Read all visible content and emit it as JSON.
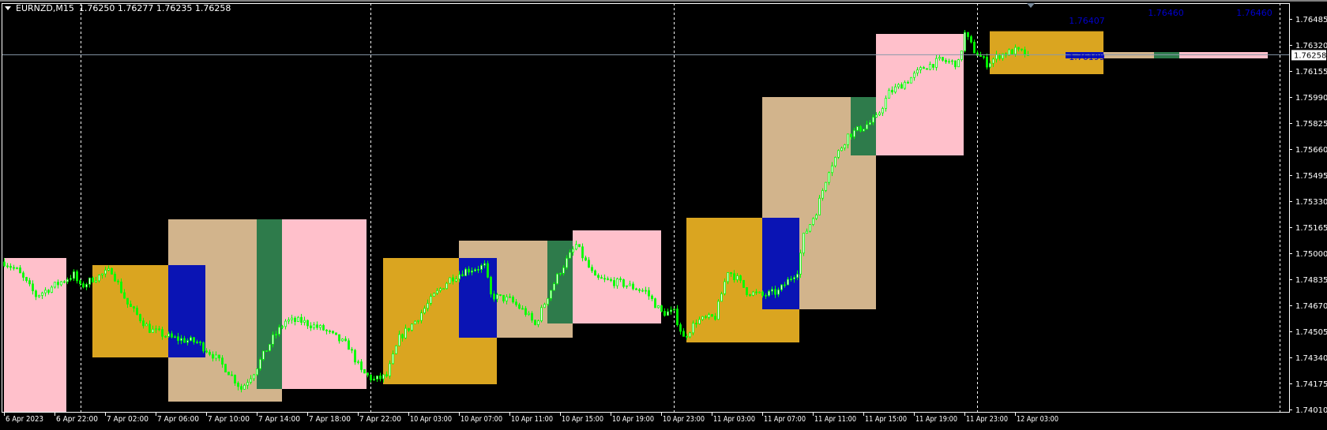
{
  "header": {
    "symbol": "EURNZD,M15",
    "ohlc": "1.76250 1.76277 1.76235 1.76258"
  },
  "colors": {
    "background": "#000000",
    "axis": "#ffffff",
    "candle": "#00ff00",
    "grid_sep": "#ffffff",
    "price_line": "#8899aa",
    "level_text": "#0000cc"
  },
  "chart_data": {
    "type": "candlestick",
    "title": "EURNZD,M15",
    "ylim": [
      1.7401,
      1.76485
    ],
    "y_ticks": [
      "1.76485",
      "1.76320",
      "1.76155",
      "1.75990",
      "1.75825",
      "1.75660",
      "1.75495",
      "1.75330",
      "1.75165",
      "1.75000",
      "1.74835",
      "1.74670",
      "1.74505",
      "1.74340",
      "1.74175",
      "1.74010"
    ],
    "current_price": "1.76258",
    "x_ticks": [
      {
        "bar": 0,
        "label": "6 Apr 2023"
      },
      {
        "bar": 16,
        "label": "6 Apr 22:00"
      },
      {
        "bar": 32,
        "label": "7 Apr 02:00"
      },
      {
        "bar": 48,
        "label": "7 Apr 06:00"
      },
      {
        "bar": 64,
        "label": "7 Apr 10:00"
      },
      {
        "bar": 80,
        "label": "7 Apr 14:00"
      },
      {
        "bar": 96,
        "label": "7 Apr 18:00"
      },
      {
        "bar": 112,
        "label": "7 Apr 22:00"
      },
      {
        "bar": 128,
        "label": "10 Apr 03:00"
      },
      {
        "bar": 144,
        "label": "10 Apr 07:00"
      },
      {
        "bar": 160,
        "label": "10 Apr 11:00"
      },
      {
        "bar": 176,
        "label": "10 Apr 15:00"
      },
      {
        "bar": 192,
        "label": "10 Apr 19:00"
      },
      {
        "bar": 208,
        "label": "10 Apr 23:00"
      },
      {
        "bar": 224,
        "label": "11 Apr 03:00"
      },
      {
        "bar": 240,
        "label": "11 Apr 07:00"
      },
      {
        "bar": 256,
        "label": "11 Apr 11:00"
      },
      {
        "bar": 272,
        "label": "11 Apr 15:00"
      },
      {
        "bar": 288,
        "label": "11 Apr 19:00"
      },
      {
        "bar": 304,
        "label": "11 Apr 23:00"
      },
      {
        "bar": 320,
        "label": "12 Apr 03:00"
      }
    ],
    "day_separators": [
      24.5,
      116.25,
      212.25,
      308.25,
      404
    ],
    "price_path": [
      [
        0,
        1.74945
      ],
      [
        4,
        1.74892
      ],
      [
        10,
        1.74731
      ],
      [
        15,
        1.74785
      ],
      [
        22,
        1.74865
      ],
      [
        24,
        1.74785
      ],
      [
        28,
        1.74838
      ],
      [
        34,
        1.74892
      ],
      [
        39,
        1.74678
      ],
      [
        46,
        1.74517
      ],
      [
        53,
        1.74463
      ],
      [
        61,
        1.74437
      ],
      [
        66,
        1.74356
      ],
      [
        71,
        1.74249
      ],
      [
        75,
        1.74142
      ],
      [
        79,
        1.74249
      ],
      [
        85,
        1.74463
      ],
      [
        89,
        1.7457
      ],
      [
        94,
        1.7457
      ],
      [
        101,
        1.74517
      ],
      [
        109,
        1.7441
      ],
      [
        113,
        1.74249
      ],
      [
        117,
        1.74196
      ],
      [
        121,
        1.74222
      ],
      [
        125,
        1.74463
      ],
      [
        130,
        1.7457
      ],
      [
        136,
        1.74731
      ],
      [
        141,
        1.74838
      ],
      [
        146,
        1.74892
      ],
      [
        152,
        1.74919
      ],
      [
        154,
        1.74731
      ],
      [
        160,
        1.74704
      ],
      [
        165,
        1.74624
      ],
      [
        168,
        1.74544
      ],
      [
        172,
        1.74731
      ],
      [
        176,
        1.74892
      ],
      [
        181,
        1.75052
      ],
      [
        187,
        1.74838
      ],
      [
        195,
        1.74811
      ],
      [
        203,
        1.74758
      ],
      [
        208,
        1.74624
      ],
      [
        212,
        1.74624
      ],
      [
        215,
        1.74463
      ],
      [
        219,
        1.7457
      ],
      [
        225,
        1.74597
      ],
      [
        229,
        1.74892
      ],
      [
        232,
        1.74838
      ],
      [
        235,
        1.74758
      ],
      [
        240,
        1.74731
      ],
      [
        245,
        1.74758
      ],
      [
        251,
        1.74892
      ],
      [
        253,
        1.75106
      ],
      [
        257,
        1.75267
      ],
      [
        261,
        1.75534
      ],
      [
        267,
        1.75748
      ],
      [
        272,
        1.75802
      ],
      [
        276,
        1.75855
      ],
      [
        280,
        1.76016
      ],
      [
        286,
        1.76096
      ],
      [
        291,
        1.76177
      ],
      [
        296,
        1.7622
      ],
      [
        302,
        1.76203
      ],
      [
        304,
        1.76391
      ],
      [
        307,
        1.76284
      ],
      [
        311,
        1.76203
      ],
      [
        315,
        1.76257
      ],
      [
        320,
        1.76284
      ],
      [
        324,
        1.76258
      ]
    ],
    "boxes": [
      {
        "kind": "pink",
        "from": 0.25,
        "to": 20,
        "top": 1.7497,
        "bottom": 1.7399
      },
      {
        "kind": "gold",
        "from": 28.25,
        "to": 52.25,
        "top": 1.74925,
        "bottom": 1.7434
      },
      {
        "kind": "tan",
        "from": 52.25,
        "to": 88.25,
        "top": 1.75215,
        "bottom": 1.7406
      },
      {
        "kind": "blue",
        "from": 52.25,
        "to": 64,
        "top": 1.74925,
        "bottom": 1.7434
      },
      {
        "kind": "green",
        "from": 80.25,
        "to": 88.25,
        "top": 1.75215,
        "bottom": 1.7414
      },
      {
        "kind": "pink",
        "from": 88.25,
        "to": 115,
        "top": 1.75215,
        "bottom": 1.7414
      },
      {
        "kind": "gold",
        "from": 120.25,
        "to": 156.25,
        "top": 1.7497,
        "bottom": 1.7417
      },
      {
        "kind": "tan",
        "from": 144.25,
        "to": 180.25,
        "top": 1.7508,
        "bottom": 1.74465
      },
      {
        "kind": "blue",
        "from": 144.25,
        "to": 156.25,
        "top": 1.7497,
        "bottom": 1.74465
      },
      {
        "kind": "green",
        "from": 172.25,
        "to": 180.25,
        "top": 1.7508,
        "bottom": 1.74555
      },
      {
        "kind": "pink",
        "from": 180.25,
        "to": 208.25,
        "top": 1.75145,
        "bottom": 1.74555
      },
      {
        "kind": "gold",
        "from": 216.25,
        "to": 252,
        "top": 1.75225,
        "bottom": 1.74435
      },
      {
        "kind": "tan",
        "from": 240.25,
        "to": 276.25,
        "top": 1.7599,
        "bottom": 1.74645
      },
      {
        "kind": "blue",
        "from": 240.25,
        "to": 252,
        "top": 1.75225,
        "bottom": 1.74645
      },
      {
        "kind": "green",
        "from": 268.25,
        "to": 276.25,
        "top": 1.7599,
        "bottom": 1.7562
      },
      {
        "kind": "pink",
        "from": 276.25,
        "to": 304,
        "top": 1.7639,
        "bottom": 1.7562
      },
      {
        "kind": "gold",
        "from": 312.25,
        "to": 348.25,
        "top": 1.76407,
        "bottom": 1.76135
      },
      {
        "kind": "blue",
        "from": 336.25,
        "to": 348.25,
        "top": 1.76275,
        "bottom": 1.76235
      },
      {
        "kind": "tan",
        "from": 348.25,
        "to": 364.25,
        "top": 1.76275,
        "bottom": 1.76235
      },
      {
        "kind": "green",
        "from": 364.25,
        "to": 372.25,
        "top": 1.76275,
        "bottom": 1.76235
      },
      {
        "kind": "pink",
        "from": 372.25,
        "to": 400.25,
        "top": 1.76275,
        "bottom": 1.76235
      }
    ],
    "box_colors": {
      "pink": "#ffc0cb",
      "gold": "#daa520",
      "tan": "#d2b48c",
      "blue": "#0a14b4",
      "green": "#2e7b4b"
    },
    "level_labels": [
      {
        "text": "1.76407",
        "bar": 343,
        "price": 1.76455
      },
      {
        "text": "1.76199",
        "bar": 343,
        "price": 1.76225
      },
      {
        "text": "1.76460",
        "bar": 368,
        "price": 1.76505
      },
      {
        "text": "1.76460",
        "bar": 396,
        "price": 1.76505
      }
    ]
  }
}
